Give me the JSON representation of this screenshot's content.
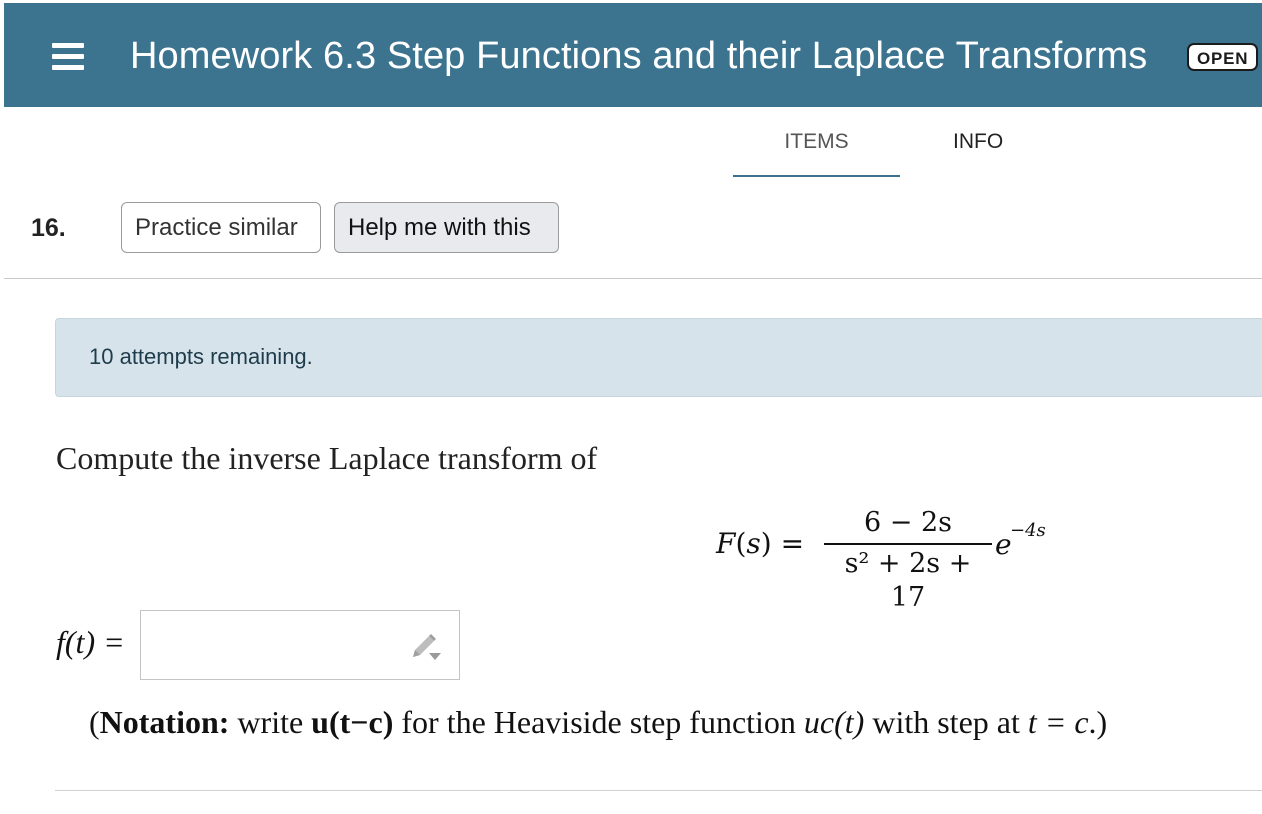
{
  "header": {
    "title": "Homework 6.3 Step Functions and their Laplace Transforms",
    "status": "OPEN",
    "menu_icon": "hamburger-menu-icon",
    "background_color": "#3c7490"
  },
  "tabs": [
    {
      "label": "ITEMS",
      "active": true
    },
    {
      "label": "INFO",
      "active": false
    }
  ],
  "question": {
    "number": "16.",
    "buttons": {
      "practice": "Practice similar",
      "help": "Help me with this"
    },
    "attempts": "10 attempts remaining.",
    "prompt": "Compute the inverse Laplace transform of",
    "equation": {
      "lhs_fn": "F",
      "lhs_arg": "s",
      "equals": "=",
      "numerator": "6 − 2s",
      "denominator": "s² + 2s + 17",
      "exponential_base": "e",
      "exponent": "−4s"
    },
    "answer": {
      "label": "f(t) =",
      "value": "",
      "editor_icon": "pencil-dropdown-icon"
    },
    "notation": {
      "open_paren": "(",
      "bold_label": "Notation:",
      "text_1": " write ",
      "bold_code": "u(t−c)",
      "text_2": " for the Heaviside step function ",
      "math": "uc(t)",
      "text_3": " with step at ",
      "math_2": "t = c",
      "close": ".)"
    }
  }
}
